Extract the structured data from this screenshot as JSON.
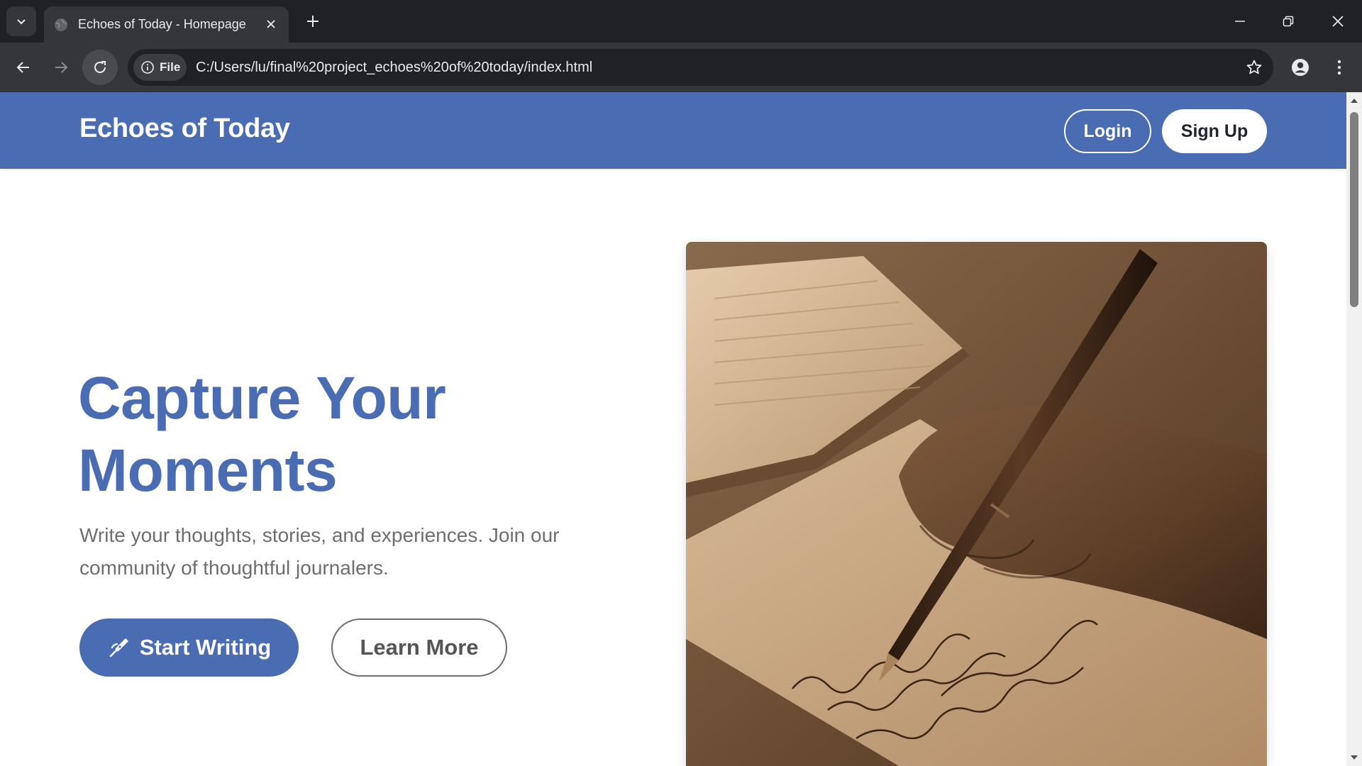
{
  "browser": {
    "tab_title": "Echoes of Today - Homepage",
    "site_chip_label": "File",
    "url": "C:/Users/lu/final%20project_echoes%20of%20today/index.html"
  },
  "header": {
    "brand": "Echoes of Today",
    "login_label": "Login",
    "signup_label": "Sign Up"
  },
  "hero": {
    "title_line1": "Capture Your",
    "title_line2": "Moments",
    "subtitle": "Write your thoughts, stories, and experiences. Join our community of thoughtful journalers.",
    "start_label": "Start Writing",
    "learn_label": "Learn More",
    "image_icon": "hand-writing-with-fountain-pen-illustration"
  },
  "colors": {
    "brand_blue": "#4a6cb3",
    "chrome_dark": "#202124",
    "chrome_mid": "#35363a"
  }
}
